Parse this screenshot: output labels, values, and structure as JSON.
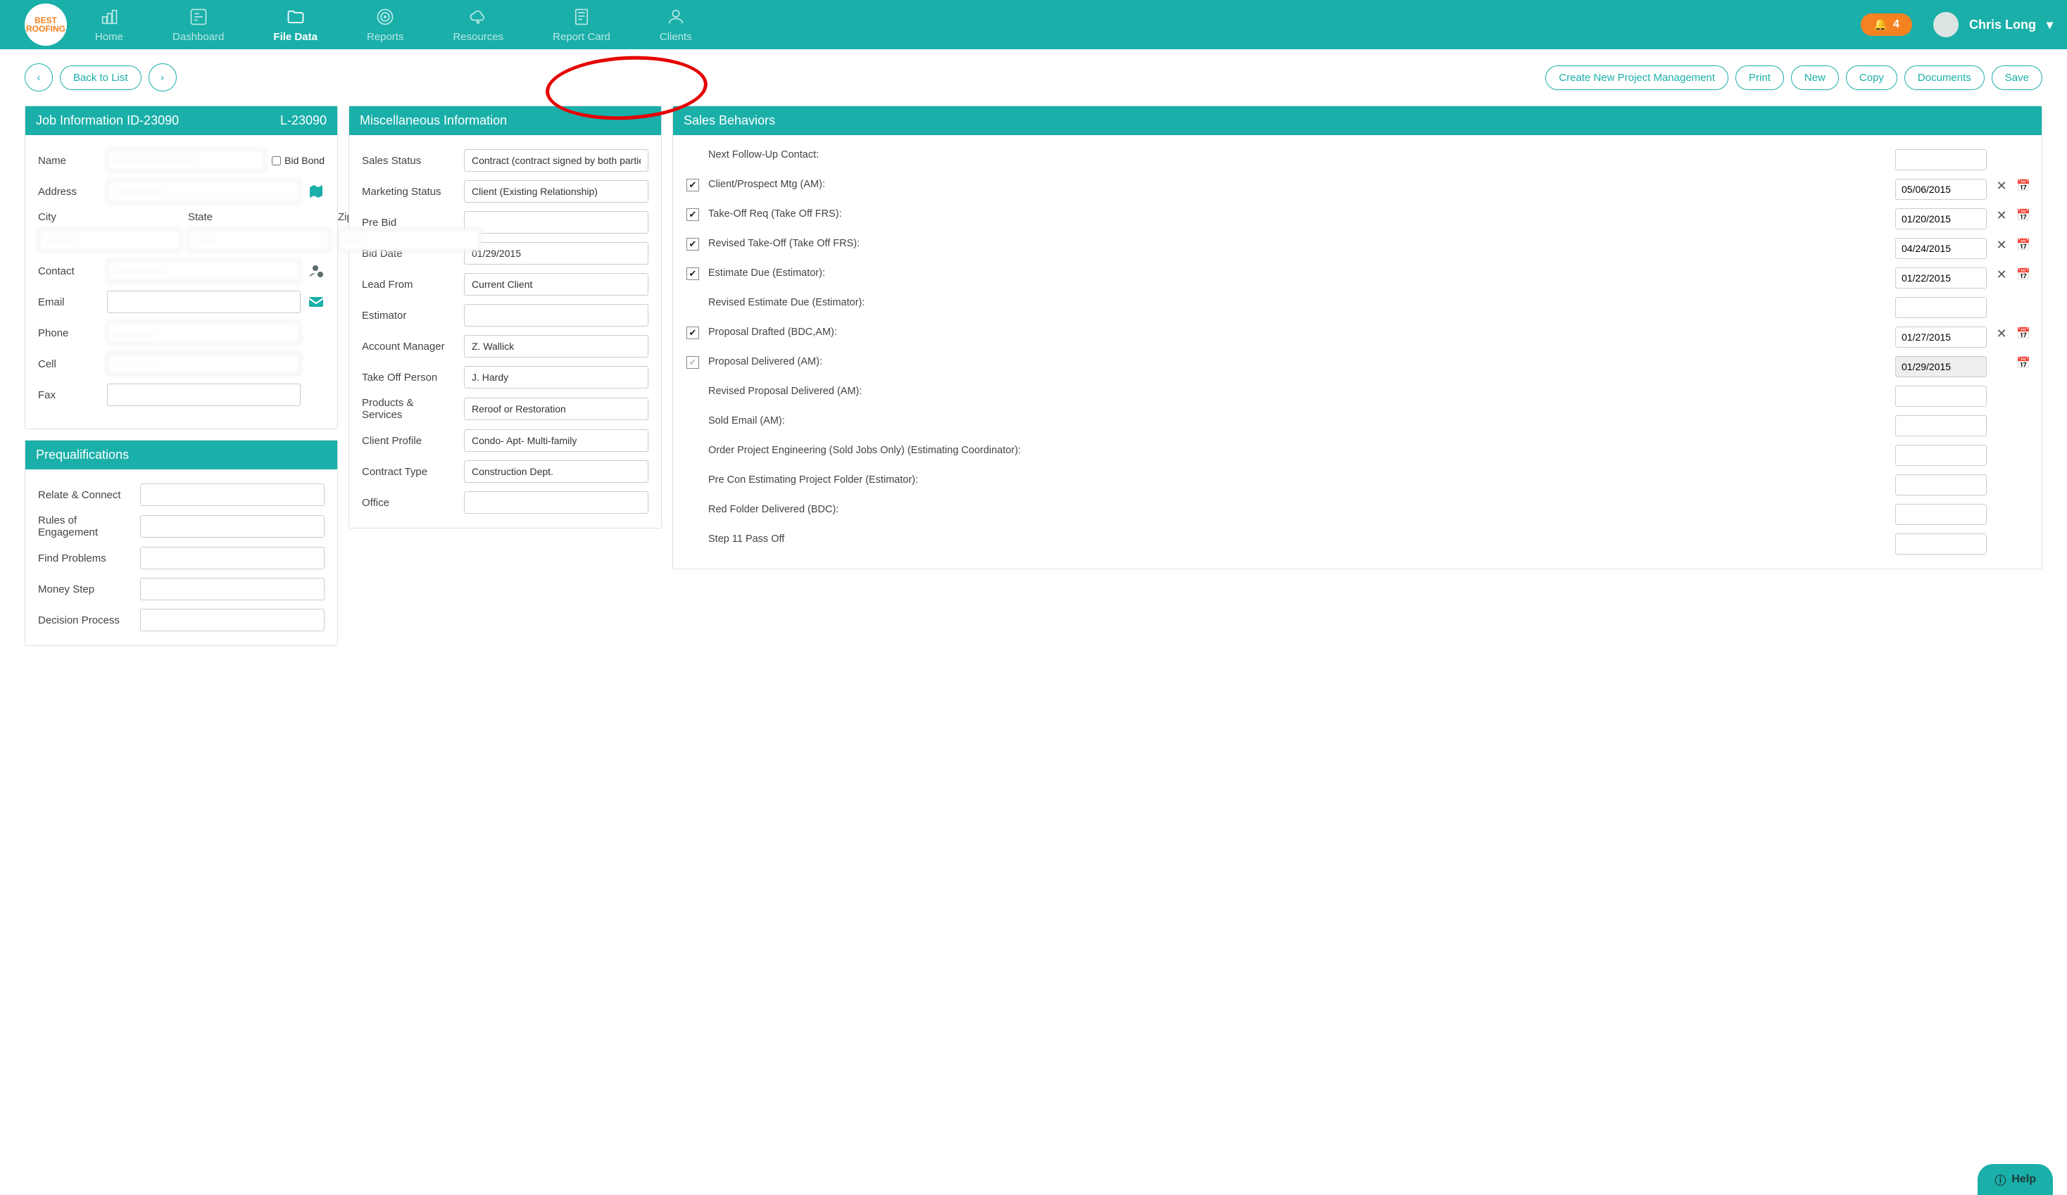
{
  "logo_text": "BEST ROOFING",
  "nav": {
    "home": "Home",
    "dashboard": "Dashboard",
    "file_data": "File Data",
    "reports": "Reports",
    "resources": "Resources",
    "report_card": "Report Card",
    "clients": "Clients"
  },
  "notif_count": "4",
  "user_name": "Chris Long",
  "toolbar": {
    "back_to_list": "Back to List",
    "create_pm": "Create New Project Management",
    "print": "Print",
    "new": "New",
    "copy": "Copy",
    "documents": "Documents",
    "save": "Save"
  },
  "job_info": {
    "title": "Job Information ID-23090",
    "code": "L-23090",
    "labels": {
      "name": "Name",
      "bid_bond": "Bid Bond",
      "address": "Address",
      "city": "City",
      "state": "State",
      "zip": "Zip",
      "contact": "Contact",
      "email": "Email",
      "phone": "Phone",
      "cell": "Cell",
      "fax": "Fax"
    }
  },
  "prequal": {
    "title": "Prequalifications",
    "labels": {
      "relate": "Relate & Connect",
      "rules": "Rules of Engagement",
      "find_problems": "Find Problems",
      "money_step": "Money Step",
      "decision": "Decision Process"
    }
  },
  "misc": {
    "title": "Miscellaneous Information",
    "labels": {
      "sales_status": "Sales Status",
      "marketing_status": "Marketing Status",
      "pre_bid": "Pre Bid",
      "bid_date": "Bid Date",
      "lead_from": "Lead From",
      "estimator": "Estimator",
      "account_manager": "Account Manager",
      "take_off": "Take Off Person",
      "products": "Products & Services",
      "client_profile": "Client Profile",
      "contract_type": "Contract Type",
      "office": "Office"
    },
    "values": {
      "sales_status": "Contract (contract signed by both parties)",
      "marketing_status": "Client (Existing Relationship)",
      "pre_bid": "",
      "bid_date": "01/29/2015",
      "lead_from": "Current Client",
      "estimator": "",
      "account_manager": "Z. Wallick",
      "take_off": "J. Hardy",
      "products": "Reroof or Restoration",
      "client_profile": "Condo- Apt- Multi-family",
      "contract_type": "Construction Dept.",
      "office": ""
    }
  },
  "sales": {
    "title": "Sales Behaviors",
    "rows": {
      "next_followup": {
        "label": "Next Follow-Up Contact:",
        "value": ""
      },
      "client_mtg": {
        "label": "Client/Prospect Mtg (AM):",
        "value": "05/06/2015"
      },
      "takeoff_req": {
        "label": "Take-Off Req (Take Off FRS):",
        "value": "01/20/2015"
      },
      "revised_takeoff": {
        "label": "Revised Take-Off (Take Off FRS):",
        "value": "04/24/2015"
      },
      "estimate_due": {
        "label": "Estimate Due (Estimator):",
        "value": "01/22/2015"
      },
      "revised_estimate": {
        "label": "Revised Estimate Due (Estimator):",
        "value": ""
      },
      "proposal_drafted": {
        "label": "Proposal Drafted (BDC,AM):",
        "value": "01/27/2015"
      },
      "proposal_delivered": {
        "label": "Proposal Delivered (AM):",
        "value": "01/29/2015"
      },
      "revised_proposal": {
        "label": "Revised Proposal Delivered (AM):",
        "value": ""
      },
      "sold_email": {
        "label": "Sold Email (AM):",
        "value": ""
      },
      "order_project": {
        "label": "Order Project Engineering (Sold Jobs Only) (Estimating Coordinator):",
        "value": ""
      },
      "precon": {
        "label": "Pre Con Estimating Project Folder (Estimator):",
        "value": ""
      },
      "red_folder": {
        "label": "Red Folder Delivered (BDC):",
        "value": ""
      },
      "step11": {
        "label": "Step 11 Pass Off",
        "value": ""
      }
    }
  },
  "help": "Help"
}
